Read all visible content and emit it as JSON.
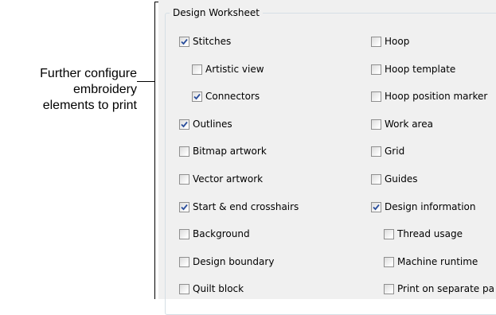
{
  "callout": {
    "lines": [
      "Further configure",
      "embroidery",
      "elements to print"
    ]
  },
  "group": {
    "title": "Design Worksheet"
  },
  "colors": {
    "check": "#2a4e9c",
    "panel": "#f0f0f0",
    "border": "#d5dfe5"
  },
  "left_column": [
    {
      "label": "Stitches",
      "checked": true,
      "indent": 0
    },
    {
      "label": "Artistic view",
      "checked": false,
      "indent": 1
    },
    {
      "label": "Connectors",
      "checked": true,
      "indent": 1
    },
    {
      "label": "Outlines",
      "checked": true,
      "indent": 0
    },
    {
      "label": "Bitmap artwork",
      "checked": false,
      "indent": 0
    },
    {
      "label": "Vector artwork",
      "checked": false,
      "indent": 0
    },
    {
      "label": "Start & end crosshairs",
      "checked": true,
      "indent": 0
    },
    {
      "label": "Background",
      "checked": false,
      "indent": 0
    },
    {
      "label": "Design boundary",
      "checked": false,
      "indent": 0
    },
    {
      "label": "Quilt block",
      "checked": false,
      "indent": 0
    }
  ],
  "right_column": [
    {
      "label": "Hoop",
      "checked": false,
      "indent": 0
    },
    {
      "label": "Hoop template",
      "checked": false,
      "indent": 0
    },
    {
      "label": "Hoop position marker",
      "checked": false,
      "indent": 0
    },
    {
      "label": "Work area",
      "checked": false,
      "indent": 0
    },
    {
      "label": "Grid",
      "checked": false,
      "indent": 0
    },
    {
      "label": "Guides",
      "checked": false,
      "indent": 0
    },
    {
      "label": "Design information",
      "checked": true,
      "indent": 0
    },
    {
      "label": "Thread usage",
      "checked": false,
      "indent": 1
    },
    {
      "label": "Machine runtime",
      "checked": false,
      "indent": 1
    },
    {
      "label": "Print on separate pa",
      "checked": false,
      "indent": 1
    }
  ]
}
